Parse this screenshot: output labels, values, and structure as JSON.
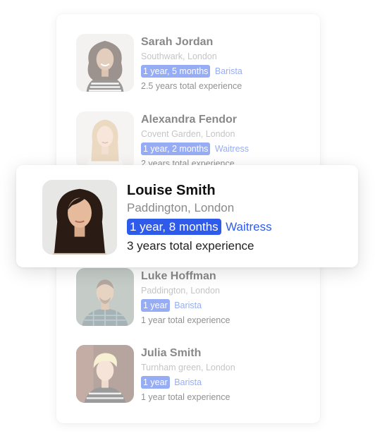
{
  "candidates": [
    {
      "name": "Sarah Jordan",
      "location": "Southwark, London",
      "duration": "1 year, 5 months",
      "role": "Barista",
      "total": "2.5 years total experience"
    },
    {
      "name": "Alexandra Fendor",
      "location": "Covent Garden, London",
      "duration": "1 year, 2 months",
      "role": "Waitress",
      "total": "2 years total experience"
    },
    {
      "name": "Luke Hoffman",
      "location": "Paddington, London",
      "duration": "1 year",
      "role": "Barista",
      "total": "1 year total experience"
    },
    {
      "name": "Julia Smith",
      "location": "Turnham green, London",
      "duration": "1 year",
      "role": "Barista",
      "total": "1 year total experience"
    }
  ],
  "featured": {
    "name": "Louise Smith",
    "location": "Paddington, London",
    "duration": "1 year, 8 months",
    "role": "Waitress",
    "total": "3 years total experience"
  },
  "colors": {
    "accent": "#2f5bea",
    "name": "#111111",
    "location": "#8a8a8a",
    "body": "#222222"
  }
}
